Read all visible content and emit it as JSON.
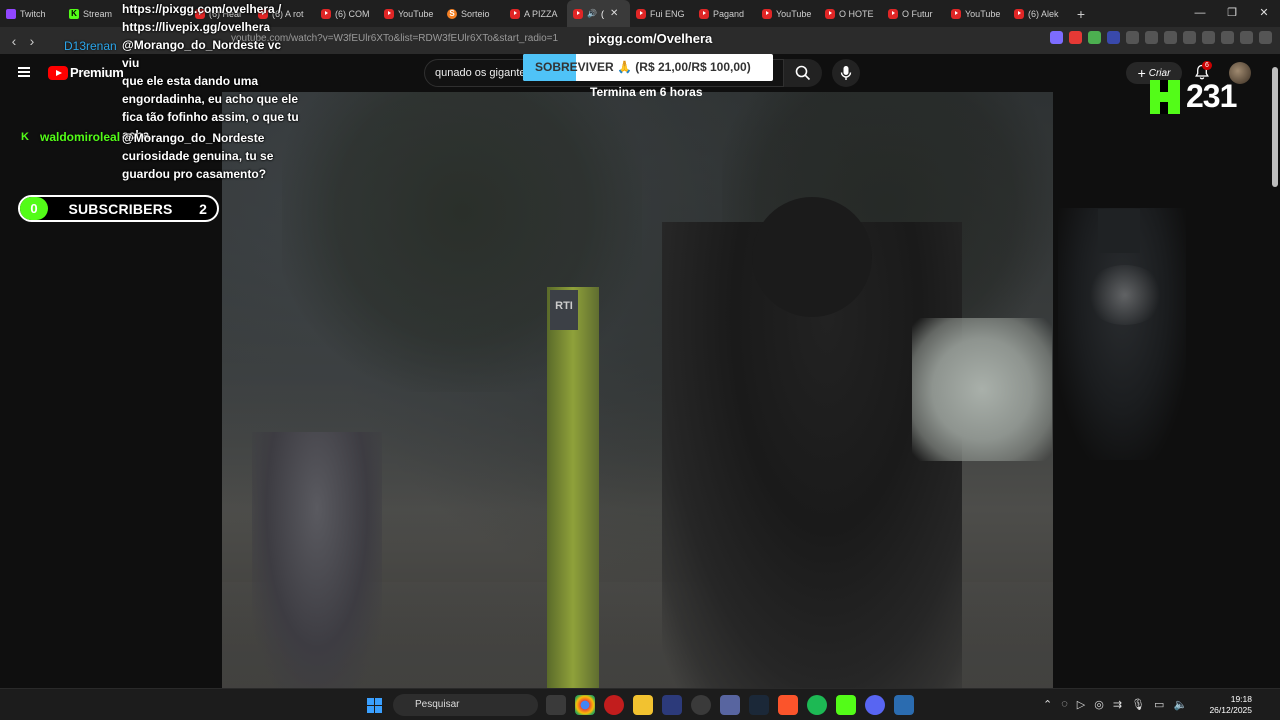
{
  "browser": {
    "tabs": [
      {
        "label": "Twitch",
        "icon": "twitch-icon",
        "active": false
      },
      {
        "label": "Stream",
        "icon": "kick-icon",
        "active": false
      },
      {
        "label": "",
        "icon": "",
        "active": false
      },
      {
        "label": "(6) Hear",
        "icon": "youtube-icon",
        "active": false
      },
      {
        "label": "(6) A rot",
        "icon": "youtube-icon",
        "active": false
      },
      {
        "label": "(6) COM",
        "icon": "youtube-icon",
        "active": false
      },
      {
        "label": "YouTube",
        "icon": "youtube-icon",
        "active": false
      },
      {
        "label": "Sorteio",
        "icon": "sorteio-icon",
        "active": false
      },
      {
        "label": "A PIZZA",
        "icon": "youtube-icon",
        "active": false
      },
      {
        "label": "(",
        "icon": "youtube-icon",
        "active": true
      },
      {
        "label": "Fui ENG",
        "icon": "youtube-icon",
        "active": false
      },
      {
        "label": "Pagand",
        "icon": "youtube-icon",
        "active": false
      },
      {
        "label": "YouTube",
        "icon": "youtube-icon",
        "active": false
      },
      {
        "label": "O HOTE",
        "icon": "youtube-icon",
        "active": false
      },
      {
        "label": "O Futur",
        "icon": "youtube-icon",
        "active": false
      },
      {
        "label": "YouTube",
        "icon": "youtube-icon",
        "active": false
      },
      {
        "label": "(6) Alek",
        "icon": "youtube-icon",
        "active": false
      }
    ],
    "url": "youtube.com/watch?v=W3fEUlr6XTo&list=RDW3fEUlr6XTo&start_radio=1"
  },
  "youtube": {
    "brand": "Premium",
    "search_value": "qunado os gigantes",
    "create_label": "Criar",
    "notifications_count": "6"
  },
  "overlay": {
    "chat": [
      {
        "user": "",
        "text_lines": [
          "https://pixgg.com/ovelhera /",
          "https://livepix.gg/ovelhera",
          "@Morango_do_Nordeste vc viu",
          "que ele esta dando uma",
          "engordadinha, eu acho que ele",
          "fica tão fofinho assim, o que tu",
          "acha"
        ]
      },
      {
        "user": "waldomiroleal",
        "text_lines": [
          "@Morango_do_Nordeste",
          "curiosidade genuina, tu se",
          "guardou pro casamento?"
        ]
      }
    ],
    "ghost_user": "D13renan",
    "subs_left": "0",
    "subs_label": "SUBSCRIBERS",
    "subs_right": "2",
    "pix_domain": "pixgg.com/Ovelhera",
    "goal_text": "SOBREVIVER 🙏 (R$ 21,00/R$ 100,00)",
    "goal_progress": 0.21,
    "goal_ends": "Termina em 6 horas",
    "kick_viewers": "231"
  },
  "taskbar": {
    "search_placeholder": "Pesquisar",
    "time": "19:18",
    "date": "26/12/2025"
  }
}
